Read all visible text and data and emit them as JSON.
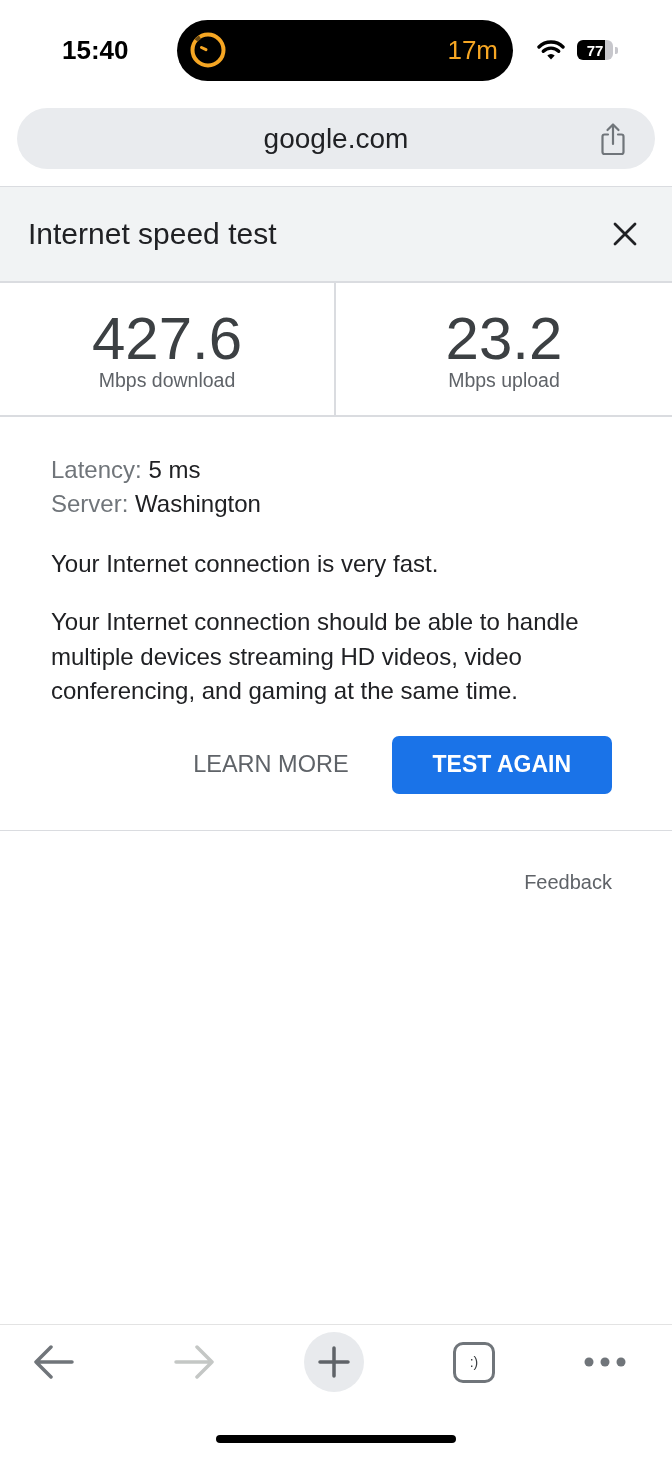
{
  "status_bar": {
    "time": "15:40",
    "activity": {
      "timer": "17m"
    },
    "battery": "77"
  },
  "address_bar": {
    "url": "google.com"
  },
  "panel": {
    "title": "Internet speed test",
    "results": [
      {
        "value": "427.6",
        "unit": "Mbps download"
      },
      {
        "value": "23.2",
        "unit": "Mbps upload"
      }
    ],
    "details": [
      {
        "label": "Latency:",
        "value": "5 ms"
      },
      {
        "label": "Server:",
        "value": "Washington"
      }
    ],
    "summary": "Your Internet connection is very fast.",
    "description": "Your Internet connection should be able to handle multiple devices streaming HD videos, video conferencing, and gaming at the same time.",
    "actions": [
      {
        "label": "LEARN MORE",
        "kind": "link"
      },
      {
        "label": "TEST AGAIN",
        "kind": "primary"
      }
    ],
    "feedback": "Feedback"
  },
  "toolbar": [
    {
      "kind": "back",
      "disabled": false
    },
    {
      "kind": "forward",
      "disabled": true
    },
    {
      "kind": "new_tab",
      "disabled": false
    },
    {
      "kind": "tabs",
      "label": ":)",
      "disabled": false
    },
    {
      "kind": "menu",
      "disabled": false
    }
  ]
}
